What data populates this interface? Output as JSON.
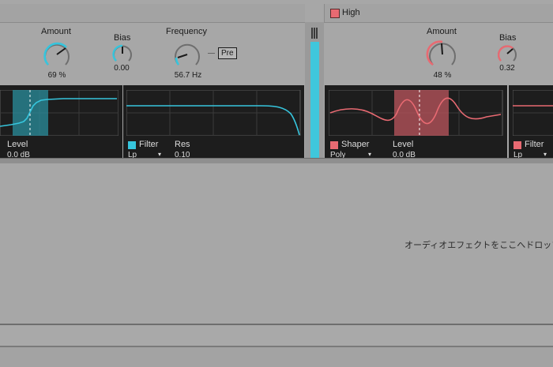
{
  "colors": {
    "accent_blue": "#36c5dd",
    "accent_red": "#e86a72",
    "panel": "#a7a7a7",
    "screen": "#1d1d1d"
  },
  "left_device": {
    "amount": {
      "label": "Amount",
      "value": "69 %",
      "level": 0.69
    },
    "bias": {
      "label": "Bias",
      "value": "0.00",
      "level": 0.5
    },
    "frequency": {
      "label": "Frequency",
      "value": "56.7 Hz",
      "level": 0.3
    },
    "pre_button": "Pre",
    "level_label": "Level",
    "level_value": "0.0 dB",
    "filter_label": "Filter",
    "filter_type": "Lp",
    "res_label": "Res",
    "res_value": "0.10"
  },
  "right_device": {
    "band_name": "High",
    "amount": {
      "label": "Amount",
      "value": "48 %",
      "level": 0.48
    },
    "bias": {
      "label": "Bias",
      "value": "0.32",
      "level": 0.66
    },
    "shaper_label": "Shaper",
    "shaper_type": "Poly",
    "level_label": "Level",
    "level_value": "0.0 dB",
    "filter_label": "Filter",
    "filter_type": "Lp"
  },
  "drop_zone": {
    "text": "オーディオエフェクトをここへドロップ"
  }
}
